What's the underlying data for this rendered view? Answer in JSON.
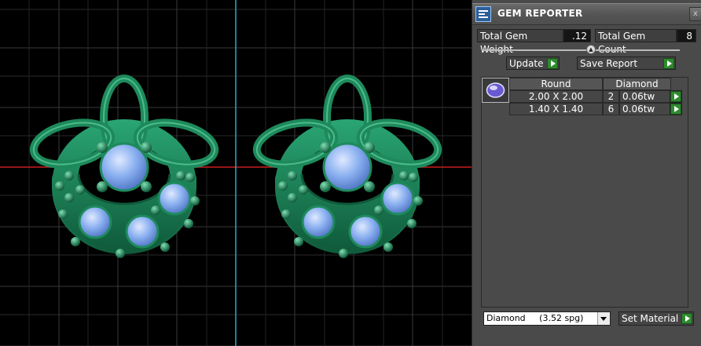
{
  "panel": {
    "title": "GEM REPORTER",
    "close_label": "x",
    "total_weight_label": "Total Gem Weight",
    "total_weight_value": ".12",
    "total_count_label": "Total Gem Count",
    "total_count_value": "8",
    "update_label": "Update",
    "save_report_label": "Save Report",
    "table": {
      "headers": [
        "Round",
        "Diamond"
      ],
      "rows": [
        {
          "size": "2.00 X 2.00",
          "count": "2",
          "weight": "0.06tw"
        },
        {
          "size": "1.40 X 1.40",
          "count": "6",
          "weight": "0.06tw"
        }
      ]
    },
    "material": {
      "name": "Diamond",
      "density": "(3.52 spg)"
    },
    "set_material_label": "Set Material"
  },
  "colors": {
    "metal": "#1e8a5c",
    "metal_highlight": "#5fd0a0",
    "gem": "#8ab0f0",
    "grid": "#3a3a3a",
    "axis_red": "#c81e1e",
    "axis_cyan": "#2aa7c8",
    "button_go": "#2f8a2f"
  },
  "icons": [
    "gem-reporter-app-icon",
    "round-gem-thumbnail-icon",
    "play-arrow-icon",
    "dropdown-chevron-icon",
    "slider-knob-icon"
  ]
}
